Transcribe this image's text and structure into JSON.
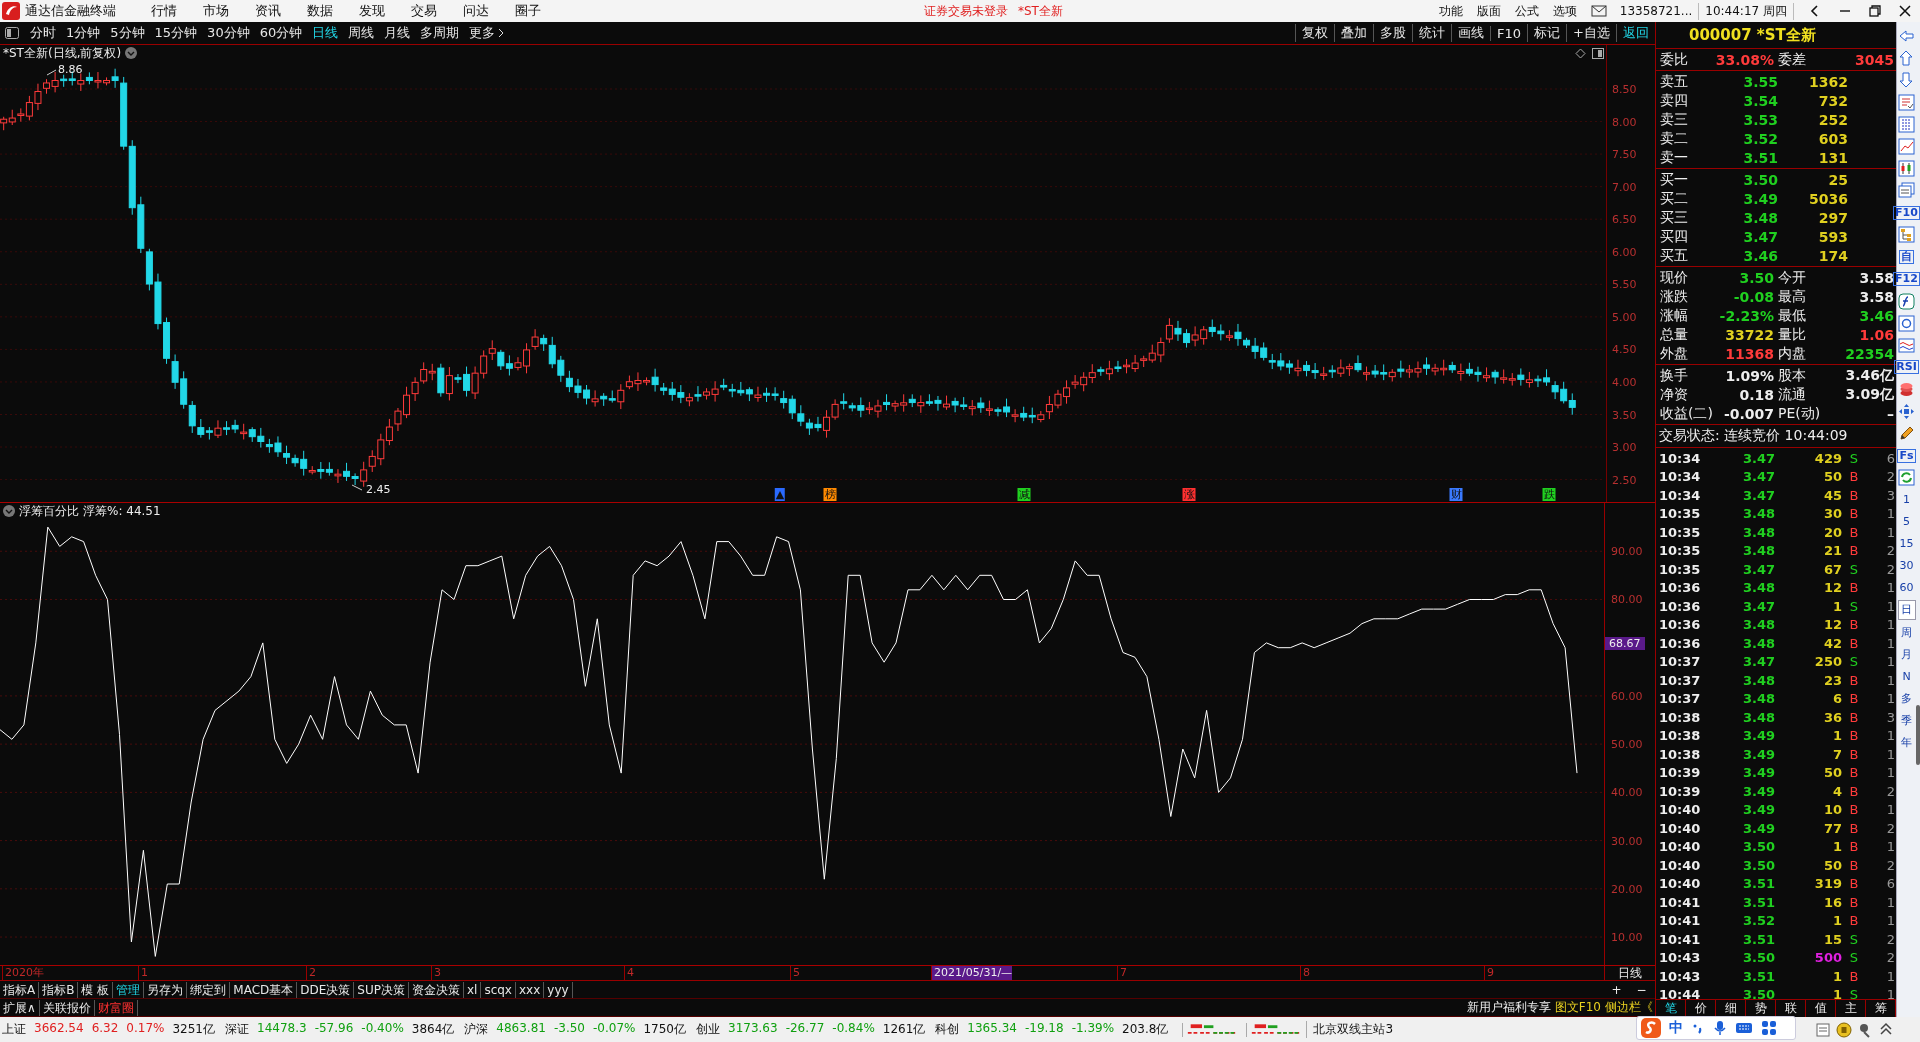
{
  "menubar": {
    "app_title": "通达信金融终端",
    "menus": [
      "行情",
      "市场",
      "资讯",
      "数据",
      "发现",
      "交易",
      "问达",
      "圈子"
    ],
    "notice": "证券交易未登录",
    "notice_stock": "*ST全新",
    "tools": [
      "功能",
      "版面",
      "公式",
      "选项"
    ],
    "account": "13358721...",
    "clock": "10:44:17 周四"
  },
  "period_bar": {
    "periods": [
      {
        "label": "分时",
        "selected": false
      },
      {
        "label": "1分钟",
        "selected": false
      },
      {
        "label": "5分钟",
        "selected": false
      },
      {
        "label": "15分钟",
        "selected": false
      },
      {
        "label": "30分钟",
        "selected": false
      },
      {
        "label": "60分钟",
        "selected": false
      },
      {
        "label": "日线",
        "selected": true
      },
      {
        "label": "周线",
        "selected": false
      },
      {
        "label": "月线",
        "selected": false
      },
      {
        "label": "多周期",
        "selected": false
      }
    ],
    "more": "更多",
    "actions": [
      {
        "label": "复权",
        "active": false
      },
      {
        "label": "叠加",
        "active": false
      },
      {
        "label": "多股",
        "active": false
      },
      {
        "label": "统计",
        "active": false
      },
      {
        "label": "画线",
        "active": false
      },
      {
        "label": "F10",
        "active": false
      },
      {
        "label": "标记",
        "active": false
      },
      {
        "label": "+自选",
        "active": false
      },
      {
        "label": "返回",
        "active": true
      }
    ]
  },
  "quote_header": "000007 *ST全新",
  "price_chart": {
    "title": "*ST全新(日线,前复权)",
    "high_label": "8.86",
    "low_label": "2.45",
    "axis_labels": [
      "8.50",
      "8.00",
      "7.50",
      "7.00",
      "6.50",
      "6.00",
      "5.50",
      "5.00",
      "4.50",
      "4.00",
      "3.50",
      "3.00",
      "2.50"
    ],
    "markers": [
      {
        "text": "▲",
        "color": "#2a6aff"
      },
      {
        "text": "榜",
        "color": "#ff8a00"
      },
      {
        "text": "减",
        "color": "#20d020"
      },
      {
        "text": "涨",
        "color": "#ff3030"
      },
      {
        "text": "财",
        "color": "#3a7aff"
      },
      {
        "text": "跌",
        "color": "#20d020"
      }
    ]
  },
  "indicator": {
    "name": "浮筹百分比",
    "reading": "浮筹%: 44.51",
    "cursor_value": "68.67",
    "chart_data": {
      "type": "line",
      "grid": true,
      "ylim": [
        4,
        100
      ],
      "yticks": [
        {
          "value": 90,
          "label": "90.00"
        },
        {
          "value": 80,
          "label": "80.00"
        },
        {
          "value": 60,
          "label": "60.00"
        },
        {
          "value": 50,
          "label": "50.00"
        },
        {
          "value": 40,
          "label": "40.00"
        },
        {
          "value": 30,
          "label": "30.00"
        },
        {
          "value": 20,
          "label": "20.00"
        },
        {
          "value": 10,
          "label": "10.00"
        }
      ],
      "series": [
        {
          "color": "#ffffff",
          "values": [
            53,
            51,
            54,
            71,
            95,
            91,
            93,
            92,
            85,
            80,
            52,
            9,
            28,
            6,
            21,
            21,
            38,
            51,
            57,
            59,
            61,
            64,
            71,
            51,
            46,
            50,
            56,
            51,
            64,
            54,
            51,
            61,
            56,
            54,
            54,
            44,
            67,
            82,
            80,
            87,
            87,
            88,
            89,
            76,
            85,
            89,
            91,
            87,
            80,
            62,
            76,
            54,
            44,
            85,
            88,
            87,
            89,
            92,
            85,
            76,
            92,
            92,
            89,
            85,
            85,
            93,
            92,
            82,
            49,
            22,
            47,
            85,
            85,
            71,
            67,
            71,
            82,
            82,
            85,
            82,
            85,
            82,
            85,
            85,
            80,
            80,
            82,
            71,
            74,
            80,
            88,
            85,
            85,
            76,
            69,
            68,
            64,
            51,
            35,
            49,
            43,
            57,
            40,
            43,
            51,
            69,
            71,
            70,
            70,
            71,
            70,
            71,
            72,
            73,
            75,
            76,
            76,
            76,
            77,
            78,
            78,
            78,
            79,
            80,
            80,
            80,
            81,
            81,
            82,
            82,
            75,
            70,
            44
          ]
        }
      ]
    }
  },
  "time_axis": {
    "labels": [
      {
        "text": "2020年",
        "selected": false
      },
      {
        "text": "1",
        "selected": false
      },
      {
        "text": "2",
        "selected": false
      },
      {
        "text": "3",
        "selected": false
      },
      {
        "text": "4",
        "selected": false
      },
      {
        "text": "5",
        "selected": false
      },
      {
        "text": "2021/05/31/—",
        "selected": true
      },
      {
        "text": "7",
        "selected": false
      },
      {
        "text": "8",
        "selected": false
      },
      {
        "text": "9",
        "selected": false
      }
    ],
    "period": "日线",
    "zoom_buttons": [
      "+",
      "−"
    ]
  },
  "indicator_tabs": [
    {
      "label": "指标A",
      "selected": false
    },
    {
      "label": "指标B",
      "selected": false
    },
    {
      "label": "模 板",
      "selected": false
    },
    {
      "label": "管理",
      "selected": true
    },
    {
      "label": "另存为",
      "selected": false
    },
    {
      "label": "绑定到",
      "selected": false
    },
    {
      "label": "MACD基本",
      "selected": false
    },
    {
      "label": "DDE决策",
      "selected": false
    },
    {
      "label": "SUP决策",
      "selected": false
    },
    {
      "label": "资金决策",
      "selected": false
    },
    {
      "label": "xl",
      "selected": false
    },
    {
      "label": "scqx",
      "selected": false
    },
    {
      "label": "xxx",
      "selected": false
    },
    {
      "label": "yyy",
      "selected": false
    }
  ],
  "extra_tabs": [
    {
      "label": "扩展∧",
      "accent": false
    },
    {
      "label": "关联报价",
      "accent": false
    },
    {
      "label": "财富圈",
      "accent": true
    }
  ],
  "promo_links": [
    {
      "label": "新用户福利专享",
      "accent": false
    },
    {
      "label": "图文F10",
      "accent": true
    },
    {
      "label": "侧边栏《",
      "accent": true
    }
  ],
  "quote_panel": {
    "ratio": {
      "label": "委比",
      "value": "33.08%",
      "label2": "委差",
      "value2": "3045"
    },
    "asks": [
      {
        "label": "卖五",
        "price": "3.55",
        "volume": "1362"
      },
      {
        "label": "卖四",
        "price": "3.54",
        "volume": "732"
      },
      {
        "label": "卖三",
        "price": "3.53",
        "volume": "252"
      },
      {
        "label": "卖二",
        "price": "3.52",
        "volume": "603"
      },
      {
        "label": "卖一",
        "price": "3.51",
        "volume": "131"
      }
    ],
    "bids": [
      {
        "label": "买一",
        "price": "3.50",
        "volume": "25"
      },
      {
        "label": "买二",
        "price": "3.49",
        "volume": "5036"
      },
      {
        "label": "买三",
        "price": "3.48",
        "volume": "297"
      },
      {
        "label": "买四",
        "price": "3.47",
        "volume": "593"
      },
      {
        "label": "买五",
        "price": "3.46",
        "volume": "174"
      }
    ],
    "stats": [
      {
        "left": {
          "label": "现价",
          "value": "3.50",
          "color": "#20d020"
        },
        "right": {
          "label": "今开",
          "value": "3.58",
          "color": "#eeeeee"
        }
      },
      {
        "left": {
          "label": "涨跌",
          "value": "-0.08",
          "color": "#20d020"
        },
        "right": {
          "label": "最高",
          "value": "3.58",
          "color": "#eeeeee"
        }
      },
      {
        "left": {
          "label": "涨幅",
          "value": "-2.23%",
          "color": "#20d020"
        },
        "right": {
          "label": "最低",
          "value": "3.46",
          "color": "#20d020"
        }
      },
      {
        "left": {
          "label": "总量",
          "value": "33722",
          "color": "#e0d020"
        },
        "right": {
          "label": "量比",
          "value": "1.06",
          "color": "#ff3b3b"
        }
      },
      {
        "left": {
          "label": "外盘",
          "value": "11368",
          "color": "#ff3b3b"
        },
        "right": {
          "label": "内盘",
          "value": "22354",
          "color": "#20d020"
        }
      }
    ],
    "fundamentals": [
      {
        "label": "换手",
        "value": "1.09%",
        "label2": "股本",
        "value2": "3.46亿"
      },
      {
        "label": "净资",
        "value": "0.18",
        "label2": "流通",
        "value2": "3.09亿"
      },
      {
        "label": "收益(二)",
        "value": "-0.007",
        "label2": "PE(动)",
        "value2": "–"
      }
    ],
    "trade_status": "交易状态: 连续竞价 10:44:09"
  },
  "ticks": [
    {
      "time": "10:34",
      "price": "3.47",
      "volume": "429",
      "side": "S",
      "count": "6",
      "buy": false,
      "large": false
    },
    {
      "time": "10:34",
      "price": "3.47",
      "volume": "50",
      "side": "B",
      "count": "2",
      "buy": true,
      "large": false
    },
    {
      "time": "10:34",
      "price": "3.47",
      "volume": "45",
      "side": "B",
      "count": "3",
      "buy": true,
      "large": false
    },
    {
      "time": "10:35",
      "price": "3.48",
      "volume": "30",
      "side": "B",
      "count": "1",
      "buy": true,
      "large": false
    },
    {
      "time": "10:35",
      "price": "3.48",
      "volume": "20",
      "side": "B",
      "count": "1",
      "buy": true,
      "large": false
    },
    {
      "time": "10:35",
      "price": "3.48",
      "volume": "21",
      "side": "B",
      "count": "2",
      "buy": true,
      "large": false
    },
    {
      "time": "10:35",
      "price": "3.47",
      "volume": "67",
      "side": "S",
      "count": "2",
      "buy": false,
      "large": false
    },
    {
      "time": "10:36",
      "price": "3.48",
      "volume": "12",
      "side": "B",
      "count": "1",
      "buy": true,
      "large": false
    },
    {
      "time": "10:36",
      "price": "3.47",
      "volume": "1",
      "side": "S",
      "count": "1",
      "buy": false,
      "large": false
    },
    {
      "time": "10:36",
      "price": "3.48",
      "volume": "12",
      "side": "B",
      "count": "1",
      "buy": true,
      "large": false
    },
    {
      "time": "10:36",
      "price": "3.48",
      "volume": "42",
      "side": "B",
      "count": "1",
      "buy": true,
      "large": false
    },
    {
      "time": "10:37",
      "price": "3.47",
      "volume": "250",
      "side": "S",
      "count": "1",
      "buy": false,
      "large": false
    },
    {
      "time": "10:37",
      "price": "3.48",
      "volume": "23",
      "side": "B",
      "count": "1",
      "buy": true,
      "large": false
    },
    {
      "time": "10:37",
      "price": "3.48",
      "volume": "6",
      "side": "B",
      "count": "1",
      "buy": true,
      "large": false
    },
    {
      "time": "10:38",
      "price": "3.48",
      "volume": "36",
      "side": "B",
      "count": "3",
      "buy": true,
      "large": false
    },
    {
      "time": "10:38",
      "price": "3.49",
      "volume": "1",
      "side": "B",
      "count": "1",
      "buy": true,
      "large": false
    },
    {
      "time": "10:38",
      "price": "3.49",
      "volume": "7",
      "side": "B",
      "count": "1",
      "buy": true,
      "large": false
    },
    {
      "time": "10:39",
      "price": "3.49",
      "volume": "50",
      "side": "B",
      "count": "1",
      "buy": true,
      "large": false
    },
    {
      "time": "10:39",
      "price": "3.49",
      "volume": "4",
      "side": "B",
      "count": "2",
      "buy": true,
      "large": false
    },
    {
      "time": "10:40",
      "price": "3.49",
      "volume": "10",
      "side": "B",
      "count": "1",
      "buy": true,
      "large": false
    },
    {
      "time": "10:40",
      "price": "3.49",
      "volume": "77",
      "side": "B",
      "count": "2",
      "buy": true,
      "large": false
    },
    {
      "time": "10:40",
      "price": "3.50",
      "volume": "1",
      "side": "B",
      "count": "1",
      "buy": true,
      "large": false
    },
    {
      "time": "10:40",
      "price": "3.50",
      "volume": "50",
      "side": "B",
      "count": "2",
      "buy": true,
      "large": false
    },
    {
      "time": "10:40",
      "price": "3.51",
      "volume": "319",
      "side": "B",
      "count": "6",
      "buy": true,
      "large": false
    },
    {
      "time": "10:41",
      "price": "3.51",
      "volume": "16",
      "side": "B",
      "count": "1",
      "buy": true,
      "large": false
    },
    {
      "time": "10:41",
      "price": "3.52",
      "volume": "1",
      "side": "B",
      "count": "1",
      "buy": true,
      "large": false
    },
    {
      "time": "10:41",
      "price": "3.51",
      "volume": "15",
      "side": "S",
      "count": "2",
      "buy": false,
      "large": false
    },
    {
      "time": "10:43",
      "price": "3.50",
      "volume": "500",
      "side": "S",
      "count": "2",
      "buy": false,
      "large": true
    },
    {
      "time": "10:43",
      "price": "3.51",
      "volume": "1",
      "side": "B",
      "count": "1",
      "buy": true,
      "large": false
    },
    {
      "time": "10:44",
      "price": "3.50",
      "volume": "1",
      "side": "S",
      "count": "1",
      "buy": false,
      "large": false
    }
  ],
  "detail_tabs": [
    {
      "label": "笔",
      "selected": true
    },
    {
      "label": "价",
      "selected": false
    },
    {
      "label": "细",
      "selected": false
    },
    {
      "label": "势",
      "selected": false
    },
    {
      "label": "联",
      "selected": false
    },
    {
      "label": "值",
      "selected": false
    },
    {
      "label": "主",
      "selected": false
    },
    {
      "label": "筹",
      "selected": false
    }
  ],
  "sidebar": {
    "badges": [
      "F10",
      "自",
      "F12",
      "RSI",
      "Fs"
    ],
    "periods": [
      {
        "label": "1",
        "selected": false
      },
      {
        "label": "5",
        "selected": false
      },
      {
        "label": "15",
        "selected": false
      },
      {
        "label": "30",
        "selected": false
      },
      {
        "label": "60",
        "selected": false
      },
      {
        "label": "日",
        "selected": true
      },
      {
        "label": "周",
        "selected": false
      },
      {
        "label": "月",
        "selected": false
      },
      {
        "label": "N",
        "selected": false
      },
      {
        "label": "多",
        "selected": false
      },
      {
        "label": "季",
        "selected": false
      },
      {
        "label": "年",
        "selected": false
      }
    ]
  },
  "status_bar": {
    "indices": [
      {
        "name": "上证",
        "value": "3662.54",
        "change": "6.32",
        "pct": "0.17%",
        "amount": "3251亿",
        "up": true
      },
      {
        "name": "深证",
        "value": "14478.3",
        "change": "-57.96",
        "pct": "-0.40%",
        "amount": "3864亿",
        "up": false
      },
      {
        "name": "沪深",
        "value": "4863.81",
        "change": "-3.50",
        "pct": "-0.07%",
        "amount": "1750亿",
        "up": false
      },
      {
        "name": "创业",
        "value": "3173.63",
        "change": "-26.77",
        "pct": "-0.84%",
        "amount": "1261亿",
        "up": false
      },
      {
        "name": "科创",
        "value": "1365.34",
        "change": "-19.18",
        "pct": "-1.39%",
        "amount": "203.8亿",
        "up": false
      }
    ],
    "server": "北京双线主站3"
  },
  "ime_bar": {
    "mode": "中"
  }
}
